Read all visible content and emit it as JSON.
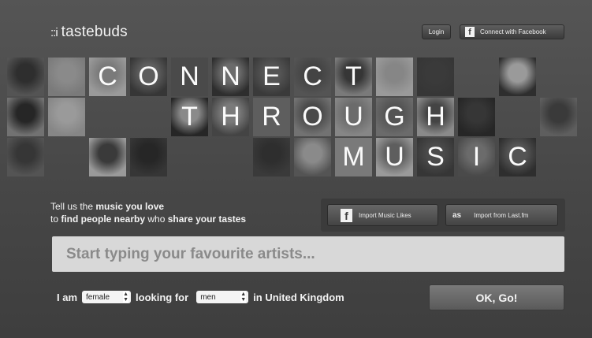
{
  "brand": {
    "dots": "::i",
    "name": "tastebuds"
  },
  "header": {
    "login_label": "Login",
    "fb_glyph": "f",
    "connect_label": "Connect with Facebook"
  },
  "hero": {
    "words": [
      {
        "text": "CONNECT",
        "letters": [
          "C",
          "O",
          "N",
          "N",
          "E",
          "C",
          "T"
        ]
      },
      {
        "text": "THROUGH",
        "letters": [
          "T",
          "H",
          "R",
          "O",
          "U",
          "G",
          "H"
        ]
      },
      {
        "text": "MUSIC",
        "letters": [
          "M",
          "U",
          "S",
          "I",
          "C"
        ]
      }
    ]
  },
  "intro": {
    "line1_pre": "Tell us the ",
    "line1_bold": "music you love",
    "line2_pre": "to ",
    "line2_bold1": "find people nearby",
    "line2_mid": " who ",
    "line2_bold2": "share your tastes"
  },
  "import": {
    "fb_glyph": "f",
    "fb_label": "Import Music Likes",
    "lastfm_glyph": "as",
    "lastfm_label": "Import from Last.fm"
  },
  "search": {
    "placeholder": "Start typing your favourite artists..."
  },
  "form": {
    "i_am": "I am",
    "gender_value": "female",
    "looking_for": "looking for",
    "seeking_value": "men",
    "in_label": "in United Kingdom"
  },
  "submit_label": "OK, Go!",
  "colors": {
    "background": "#4b4b4b",
    "search_field": "#d8d8d8",
    "button": "#6a6a6a"
  },
  "icons": [
    "facebook-icon",
    "lastfm-icon",
    "select-arrows-icon"
  ]
}
